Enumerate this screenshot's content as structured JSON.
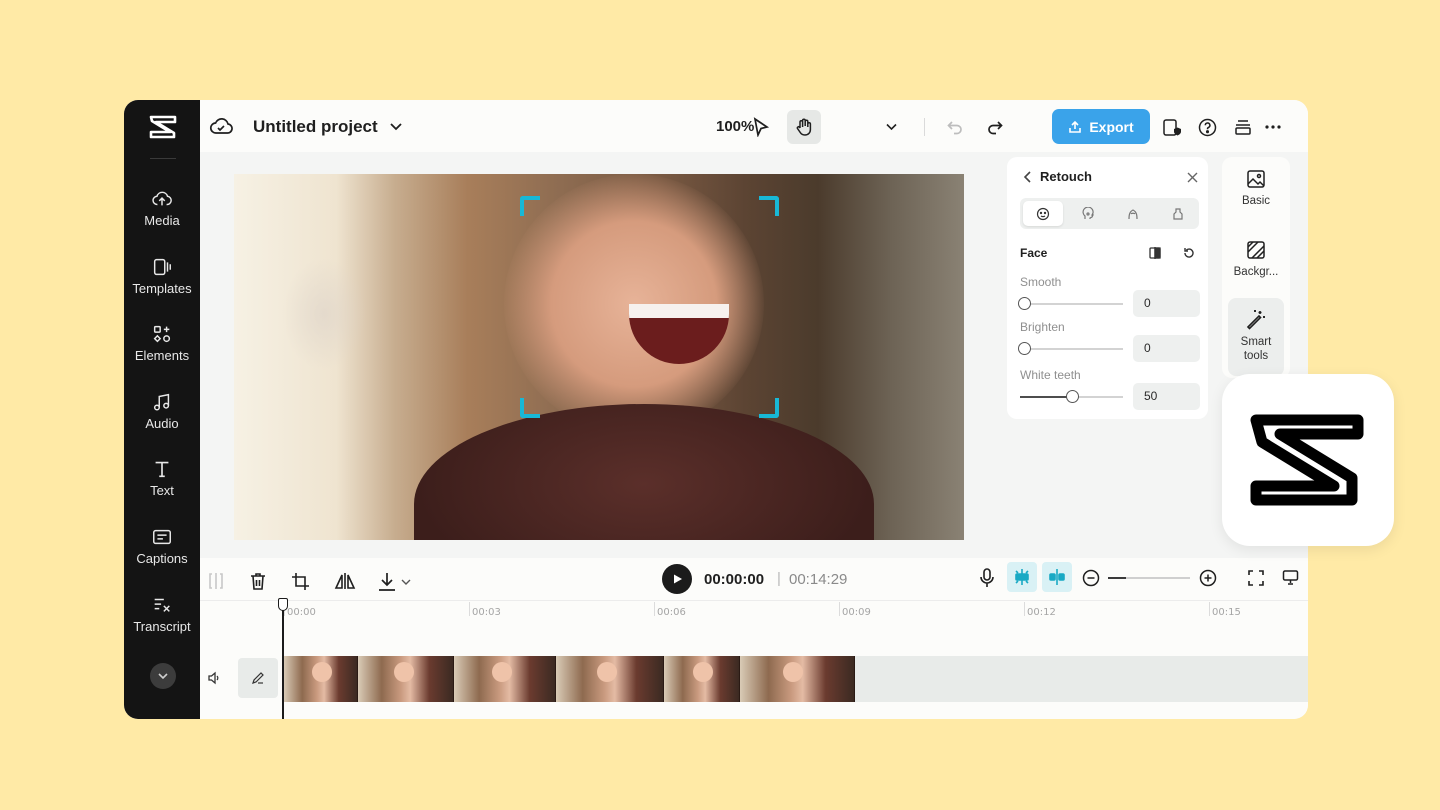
{
  "app": {
    "project_title": "Untitled project",
    "zoom_level": "100%",
    "export_label": "Export"
  },
  "sidebar": {
    "items": [
      {
        "label": "Media",
        "icon": "cloud-upload-icon"
      },
      {
        "label": "Templates",
        "icon": "templates-icon"
      },
      {
        "label": "Elements",
        "icon": "elements-icon"
      },
      {
        "label": "Audio",
        "icon": "music-note-icon"
      },
      {
        "label": "Text",
        "icon": "text-icon"
      },
      {
        "label": "Captions",
        "icon": "captions-icon"
      },
      {
        "label": "Transcript",
        "icon": "transcript-icon"
      }
    ]
  },
  "retouch": {
    "title": "Retouch",
    "section": "Face",
    "controls": [
      {
        "label": "Smooth",
        "value": "0",
        "level": 0
      },
      {
        "label": "Brighten",
        "value": "0",
        "level": 0
      },
      {
        "label": "White teeth",
        "value": "50",
        "level": 50
      }
    ]
  },
  "tools": {
    "items": [
      {
        "label": "Basic",
        "icon": "image-icon"
      },
      {
        "label": "Backgr...",
        "icon": "background-icon"
      },
      {
        "label": "Smart tools",
        "icon": "magic-wand-icon"
      }
    ]
  },
  "timeline": {
    "current_time": "00:00:00",
    "separator": "|",
    "total_time": "00:14:29",
    "ticks": [
      "00:00",
      "00:03",
      "00:06",
      "00:09",
      "00:12",
      "00:15"
    ]
  },
  "colors": {
    "background": "#ffeaa6",
    "sidebar": "#141414",
    "accent": "#3aa3ea",
    "focus_corners": "#18b8d6"
  }
}
